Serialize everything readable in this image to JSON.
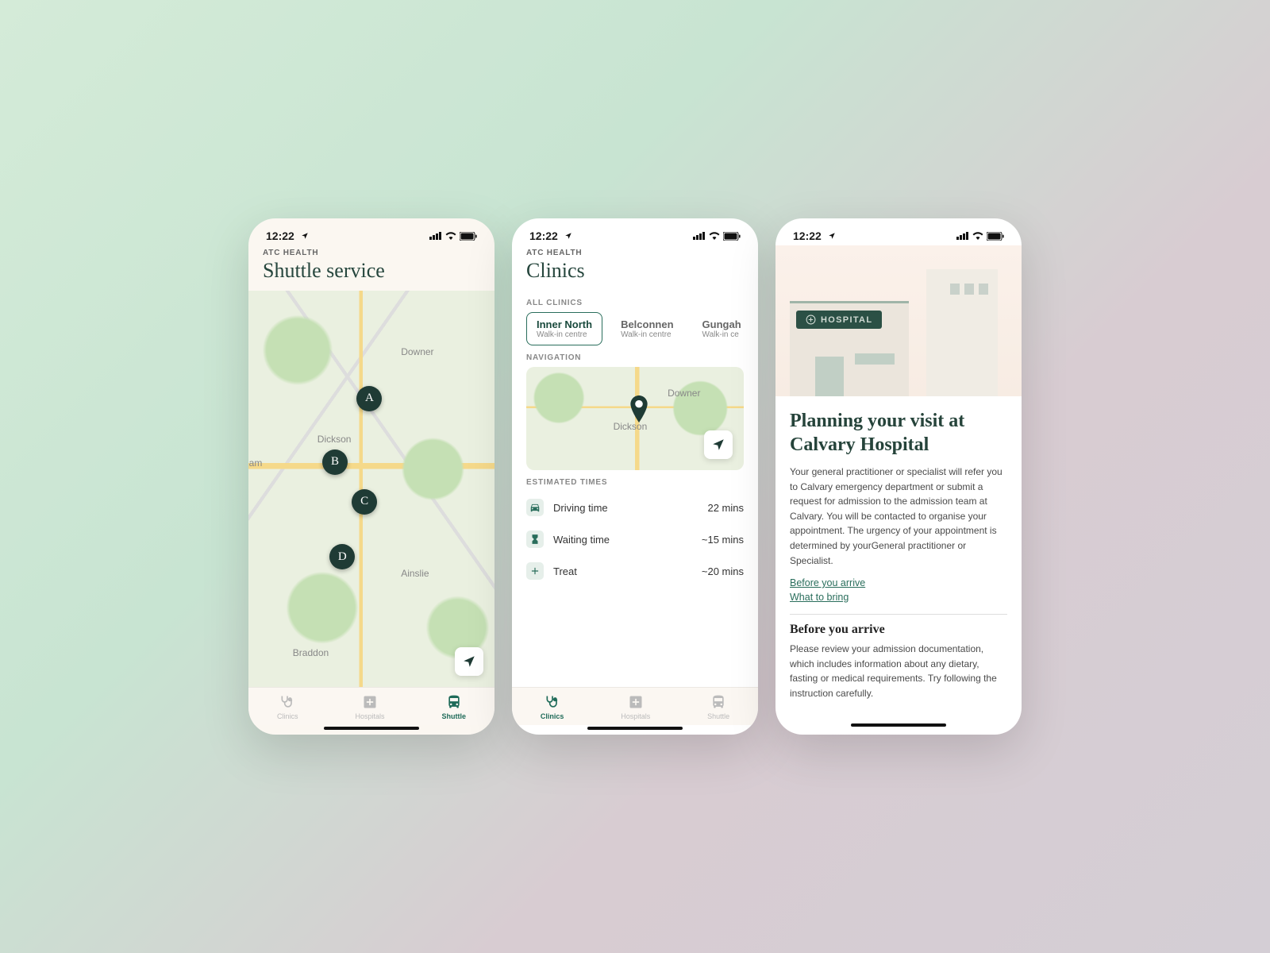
{
  "status": {
    "time": "12:22"
  },
  "app_eyebrow": "ATC HEALTH",
  "phone1": {
    "title": "Shuttle service",
    "map_labels": {
      "downer": "Downer",
      "dickson": "Dickson",
      "ainslie": "Ainslie",
      "braddon": "Braddon",
      "lyneham": "·ham"
    },
    "pins": {
      "a": "A",
      "b": "B",
      "c": "C",
      "d": "D"
    }
  },
  "phone2": {
    "title": "Clinics",
    "all_clinics_label": "ALL CLINICS",
    "clinics": [
      {
        "name": "Inner North",
        "sub": "Walk-in centre",
        "active": true
      },
      {
        "name": "Belconnen",
        "sub": "Walk-in centre",
        "active": false
      },
      {
        "name": "Gungah",
        "sub": "Walk-in ce",
        "active": false
      }
    ],
    "navigation_label": "NAVIGATION",
    "map_labels": {
      "dickson": "Dickson",
      "downer": "Downer"
    },
    "estimated_label": "ESTIMATED TIMES",
    "estimates": [
      {
        "icon": "car",
        "label": "Driving time",
        "value": "22 mins"
      },
      {
        "icon": "hourglass",
        "label": "Waiting time",
        "value": "~15 mins"
      },
      {
        "icon": "plus",
        "label": "Treat",
        "value": "~20 mins"
      }
    ]
  },
  "phone3": {
    "hospital_tag": "HOSPITAL",
    "title": "Planning your visit at Calvary Hospital",
    "body": "Your general practitioner or specialist will refer you to Calvary emergency department or submit a request for admission to the admission team at Calvary. You will be contacted to organise your appointment. The urgency of your appointment is determined by yourGeneral practitioner or Specialist.",
    "links": {
      "before": "Before you arrive",
      "bring": "What to bring"
    },
    "sub_heading": "Before you arrive",
    "sub_body": "Please review your admission documentation, which includes information about any dietary, fasting or medical requirements. Try following the instruction carefully."
  },
  "tabs": {
    "clinics": "Clinics",
    "hospitals": "Hospitals",
    "shuttle": "Shuttle"
  }
}
